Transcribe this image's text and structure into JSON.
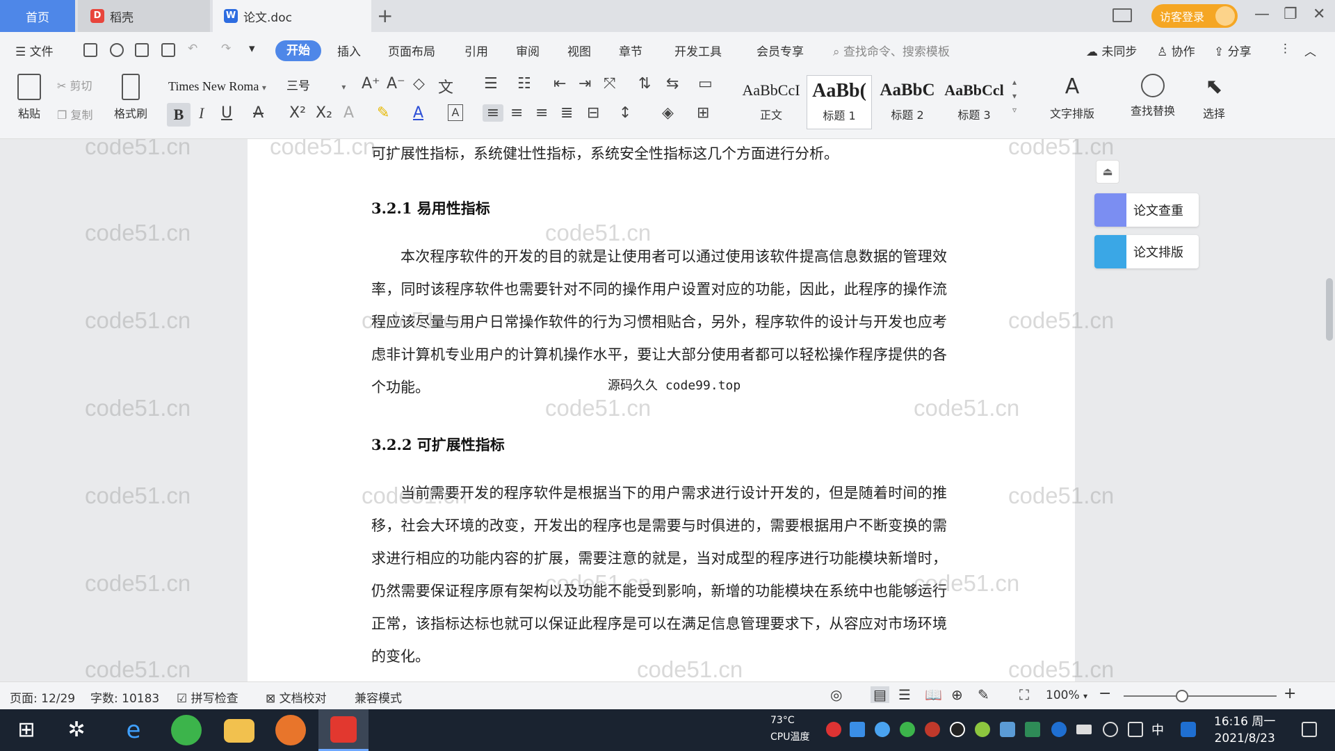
{
  "tabs": {
    "home": "首页",
    "daoke": "稻壳",
    "doc": "论文.doc"
  },
  "titlebar": {
    "login": "访客登录"
  },
  "menu": {
    "file": "文件",
    "start": "开始",
    "insert": "插入",
    "layout": "页面布局",
    "reference": "引用",
    "review": "审阅",
    "view": "视图",
    "chapter": "章节",
    "devtools": "开发工具",
    "member": "会员专享",
    "search_placeholder": "查找命令、搜索模板",
    "unsync": "未同步",
    "collab": "协作",
    "share": "分享"
  },
  "ribbon": {
    "paste": "粘贴",
    "cut": "剪切",
    "copy": "复制",
    "format_painter": "格式刷",
    "font_name": "Times New Roma",
    "font_size": "三号",
    "styles": [
      {
        "sample": "AaBbCcI",
        "name": "正文"
      },
      {
        "sample": "AaBb(",
        "name": "标题 1"
      },
      {
        "sample": "AaBbC",
        "name": "标题 2"
      },
      {
        "sample": "AaBbCcl",
        "name": "标题 3"
      }
    ],
    "text_layout": "文字排版",
    "find_replace": "查找替换",
    "select": "选择"
  },
  "document": {
    "line0": "可扩展性指标，系统健壮性指标，系统安全性指标这几个方面进行分析。",
    "h1": "3.2.1  易用性指标",
    "p1": "本次程序软件的开发的目的就是让使用者可以通过使用该软件提高信息数据的管理效率，同时该程序软件也需要针对不同的操作用户设置对应的功能，因此，此程序的操作流程应该尽量与用户日常操作软件的行为习惯相贴合，另外，程序软件的设计与开发也应考虑非计算机专业用户的计算机操作水平，要让大部分使用者都可以轻松操作程序提供的各个功能。",
    "h2": "3.2.2  可扩展性指标",
    "p2": "当前需要开发的程序软件是根据当下的用户需求进行设计开发的，但是随着时间的推移，社会大环境的改变，开发出的程序也是需要与时俱进的，需要根据用户不断变换的需求进行相应的功能内容的扩展，需要注意的就是，当对成型的程序进行功能模块新增时，仍然需要保证程序原有架构以及功能不能受到影响，新增的功能模块在系统中也能够运行正常，该指标达标也就可以保证此程序是可以在满足信息管理要求下，从容应对市场环境的变化。",
    "source_watermark": "源码久久 code99.top",
    "watermark": "code51.cn"
  },
  "side_panel": {
    "check": "论文查重",
    "format": "论文排版"
  },
  "status": {
    "page": "页面: 12/29",
    "words": "字数: 10183",
    "spell": "拼写检查",
    "proof": "文档校对",
    "compat": "兼容模式",
    "zoom": "100%",
    "zoom_level": 0.38
  },
  "taskbar": {
    "cpu_temp": "73°C",
    "cpu_label": "CPU温度",
    "ime": "中",
    "time": "16:16 周一",
    "date": "2021/8/23"
  }
}
